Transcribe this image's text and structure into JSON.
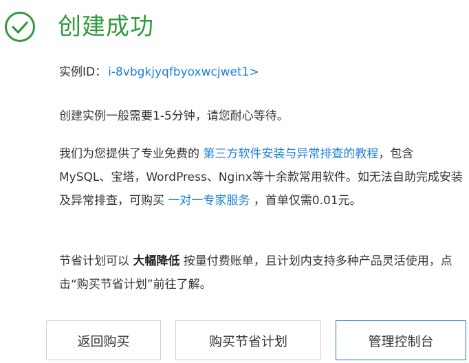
{
  "header": {
    "title": "创建成功",
    "icon": "check-circle-icon",
    "accent_color": "#2f9a3c"
  },
  "instance": {
    "label": "实例ID：",
    "id_link": "i-8vbgkjyqfbyoxwcjwet1>"
  },
  "wait_message": "创建实例一般需要1-5分钟，请您耐心等待。",
  "support": {
    "text1": "我们为您提供了专业免费的 ",
    "tutorial_link": "第三方软件安装与异常排查的教程",
    "text2": "，包含MySQL、宝塔，WordPress、Nginx等十余款常用软件。如无法自助完成安装及异常排查，可购买 ",
    "expert_link": "一对一专家服务",
    "text3": " ，首单仅需0.01元。"
  },
  "savings": {
    "text1": "节省计划可以 ",
    "emphasis": "大幅降低",
    "text2": " 按量付费账单，且计划内支持多种产品灵活使用，点击“购买节省计划”前往了解。"
  },
  "buttons": {
    "back": "返回购买",
    "buy_plan": "购买节省计划",
    "console": "管理控制台"
  },
  "colors": {
    "link": "#1a7fd6",
    "primary_border": "#1a6fc2"
  }
}
